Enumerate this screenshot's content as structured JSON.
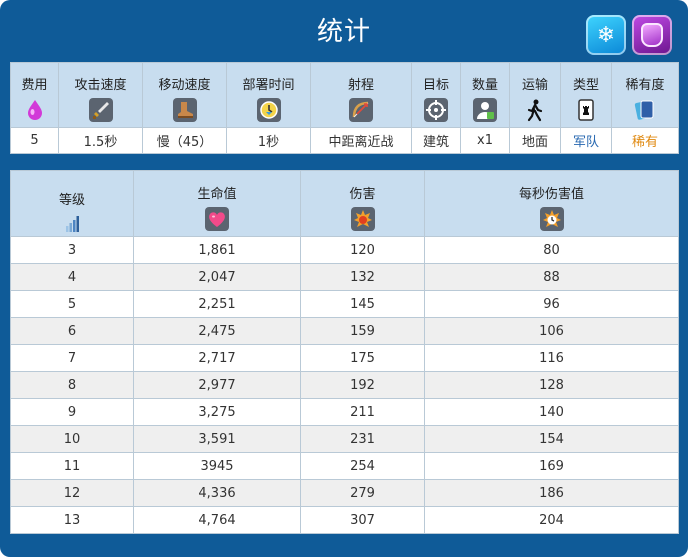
{
  "title": "统计",
  "badges": {
    "left": "freeze-card-icon",
    "right": "rage-jar-card-icon"
  },
  "info": {
    "headers": [
      "费用",
      "攻击速度",
      "移动速度",
      "部署时间",
      "射程",
      "目标",
      "数量",
      "运输",
      "类型",
      "稀有度"
    ],
    "icons": [
      "elixir-drop-icon",
      "sword-icon",
      "boot-icon",
      "clock-icon",
      "bow-icon",
      "crosshair-icon",
      "person-icon",
      "walking-icon",
      "card-icon",
      "cards-icon"
    ],
    "values": [
      "5",
      "1.5秒",
      "慢（45）",
      "1秒",
      "中距离近战",
      "建筑",
      "x1",
      "地面",
      "军队",
      "稀有"
    ]
  },
  "stats": {
    "headers": [
      "等级",
      "生命值",
      "伤害",
      "每秒伤害值"
    ],
    "icons": [
      "level-bars-icon",
      "heart-icon",
      "damage-icon",
      "dps-icon"
    ],
    "rows": [
      [
        "3",
        "1,861",
        "120",
        "80"
      ],
      [
        "4",
        "2,047",
        "132",
        "88"
      ],
      [
        "5",
        "2,251",
        "145",
        "96"
      ],
      [
        "6",
        "2,475",
        "159",
        "106"
      ],
      [
        "7",
        "2,717",
        "175",
        "116"
      ],
      [
        "8",
        "2,977",
        "192",
        "128"
      ],
      [
        "9",
        "3,275",
        "211",
        "140"
      ],
      [
        "10",
        "3,591",
        "231",
        "154"
      ],
      [
        "11",
        "3945",
        "254",
        "169"
      ],
      [
        "12",
        "4,336",
        "279",
        "186"
      ],
      [
        "13",
        "4,764",
        "307",
        "204"
      ]
    ]
  },
  "colors": {
    "panel": "#0f5b98",
    "header": "#c8ddef",
    "link": "#2667b0",
    "rare": "#e08a12"
  }
}
